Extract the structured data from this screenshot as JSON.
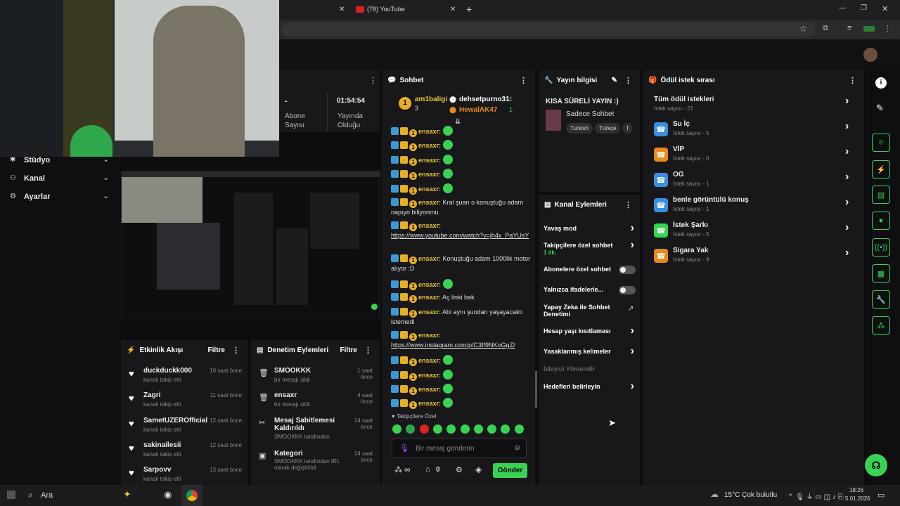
{
  "browser": {
    "tab_title": "(78) YouTube",
    "tab_close": "✕",
    "new_tab": "+",
    "win_min": "—",
    "win_max": "❐",
    "win_close": "✕"
  },
  "stats": {
    "dash": "-",
    "time": "01:54:54",
    "sub_label_1": "Abone",
    "sub_label_2": "Sayısı",
    "live_label_1": "Yayında",
    "live_label_2": "Olduğu"
  },
  "sidebar": {
    "items": [
      {
        "label": "Stüdyo"
      },
      {
        "label": "Kanal"
      },
      {
        "label": "Ayarlar"
      }
    ]
  },
  "chat": {
    "title": "Sohbet",
    "top": [
      {
        "name": "am1baligi",
        "count": "3"
      },
      {
        "name": "dehsetpurno31",
        "count": "1"
      },
      {
        "name": "HewalAK47",
        "count": "1"
      }
    ],
    "messages": [
      {
        "user": "ensaxr:",
        "text": ""
      },
      {
        "user": "ensaxr:",
        "text": ""
      },
      {
        "user": "ensaxr:",
        "text": ""
      },
      {
        "user": "ensaxr:",
        "text": ""
      },
      {
        "user": "ensaxr:",
        "text": ""
      },
      {
        "user": "ensaxr:",
        "text": "Kral şuan o konuştuğu adam napıyo biliyonmu"
      },
      {
        "user": "ensaxr:",
        "text": "https://www.youtube.com/watch?v=jh4x_PaYUsY"
      },
      {
        "user": "ensaxr:",
        "text": "Konuştuğu adam 1000lik motor alıyor :D"
      },
      {
        "user": "ensaxr:",
        "text": ""
      },
      {
        "user": "ensaxr:",
        "text": "Aç linki bak"
      },
      {
        "user": "ensaxr:",
        "text": "Abi aynı şundan yaşayacaktı istemedi"
      },
      {
        "user": "ensaxr:",
        "text": "https://www.instagram.com/p/C3If9NKoGgZ/"
      },
      {
        "user": "ensaxr:",
        "text": ""
      },
      {
        "user": "ensaxr:",
        "text": ""
      },
      {
        "user": "ensaxr:",
        "text": ""
      },
      {
        "user": "ensaxr:",
        "text": ""
      }
    ],
    "followers_only": "Takipçilere Özel",
    "input_placeholder": "Bir mesaj gönderin",
    "infinity": "∞",
    "zero": "0",
    "send": "Gönder"
  },
  "stream_info": {
    "title": "Yayın bilgisi",
    "stream_title": "KISA SÜRELİ YAYIN :)",
    "category": "Sadece Sohbet",
    "tags": [
      "Turkish",
      "Türkçe",
      "f"
    ]
  },
  "channel_actions": {
    "title": "Kanal Eylemleri",
    "items": [
      {
        "label": "Yavaş mod",
        "sub": ""
      },
      {
        "label": "Takipçilere özel sohbet",
        "sub": "1 dk."
      },
      {
        "label": "Abonelere özel sohbet",
        "sub": ""
      },
      {
        "label": "Yalnızca ifadelerle...",
        "sub": ""
      },
      {
        "label": "Yapay Zeka ile Sohbet Denetimi",
        "sub": ""
      },
      {
        "label": "Hesap yaşı kısıtlaması",
        "sub": ""
      },
      {
        "label": "Yasaklanmış kelimeler",
        "sub": ""
      },
      {
        "label": "İzleyici Yönlendir",
        "sub": ""
      },
      {
        "label": "Hedefleri belirleyin",
        "sub": ""
      }
    ]
  },
  "rewards": {
    "title": "Ödül istek sırası",
    "items": [
      {
        "label": "Tüm ödül istekleri",
        "sub": "İstek sayısı - 21",
        "color": ""
      },
      {
        "label": "Su İç",
        "sub": "İstek sayısı - 5",
        "color": "#3a8ee0"
      },
      {
        "label": "VİP",
        "sub": "İstek sayısı - 0",
        "color": "#e88a1a"
      },
      {
        "label": "OG",
        "sub": "İstek sayısı - 1",
        "color": "#3a8ee0"
      },
      {
        "label": "benle görüntülü konuş",
        "sub": "İstek sayısı - 1",
        "color": "#3a8ee0"
      },
      {
        "label": "İstek Şarkı",
        "sub": "İstek sayısı - 5",
        "color": "#39d353"
      },
      {
        "label": "Sigara Yak",
        "sub": "İstek sayısı - 9",
        "color": "#e88a1a"
      }
    ]
  },
  "activity": {
    "title": "Etkinlik Akışı",
    "filter": "Filtre",
    "items": [
      {
        "name": "duckduckk000",
        "sub": "kanalı takip etti",
        "time": "10 saat önce"
      },
      {
        "name": "Zagri",
        "sub": "kanalı takip etti",
        "time": "11 saat önce"
      },
      {
        "name": "SametUZEROfficial",
        "sub": "kanalı takip etti",
        "time": "12 saat önce"
      },
      {
        "name": "sakinailesii",
        "sub": "kanalı takip etti",
        "time": "12 saat önce"
      },
      {
        "name": "Sarpovv",
        "sub": "kanalı takip etti",
        "time": "13 saat önce"
      }
    ]
  },
  "moderation": {
    "title": "Denetim Eylemleri",
    "filter": "Filtre",
    "items": [
      {
        "name": "SMOOKKK",
        "sub": "bir mesajı sildi",
        "time": "1 saat önce"
      },
      {
        "name": "ensaxr",
        "sub": "bir mesajı sildi",
        "time": "4 saat önce"
      },
      {
        "name": "Mesaj Sabitlemesi Kaldırıldı",
        "sub": "SMOOKKK tarafından",
        "time": "14 saat önce"
      },
      {
        "name": "Kategori",
        "sub": "SMOOKKK tarafından IRL olarak değiştirildi",
        "time": "14 saat önce"
      }
    ]
  },
  "taskbar": {
    "search": "Ara",
    "weather": "15°C  Çok bulutlu",
    "clock": "18:26",
    "date": "5.01.2026"
  }
}
